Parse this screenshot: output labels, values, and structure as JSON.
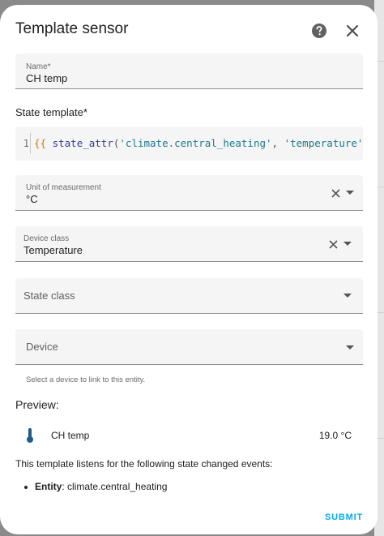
{
  "dialog": {
    "title": "Template sensor",
    "help_icon": "help-circle-icon",
    "close_icon": "close-icon"
  },
  "name_field": {
    "label": "Name*",
    "value": "CH temp"
  },
  "state_template": {
    "label": "State template*",
    "line_number": "1",
    "open_braces": "{{",
    "function": "state_attr",
    "open_paren": "(",
    "arg1": "'climate.central_heating'",
    "comma": ", ",
    "arg2": "'temperature'",
    "close_paren": ")",
    "close_braces": "}}"
  },
  "unit_field": {
    "label": "Unit of measurement",
    "value": "°C"
  },
  "device_class_field": {
    "label": "Device class",
    "value": "Temperature"
  },
  "state_class_field": {
    "placeholder": "State class"
  },
  "device_field": {
    "placeholder": "Device",
    "helper": "Select a device to link to this entity."
  },
  "preview": {
    "title": "Preview:",
    "entity_icon": "thermometer-icon",
    "entity_name": "CH temp",
    "entity_state": "19.0 °C",
    "listen_text": "This template listens for the following state changed events:",
    "bullet_label": "Entity",
    "bullet_value": ": climate.central_heating"
  },
  "actions": {
    "submit": "SUBMIT"
  },
  "colors": {
    "accent": "#03a9f4",
    "thermometer": "#1e5d8c"
  }
}
